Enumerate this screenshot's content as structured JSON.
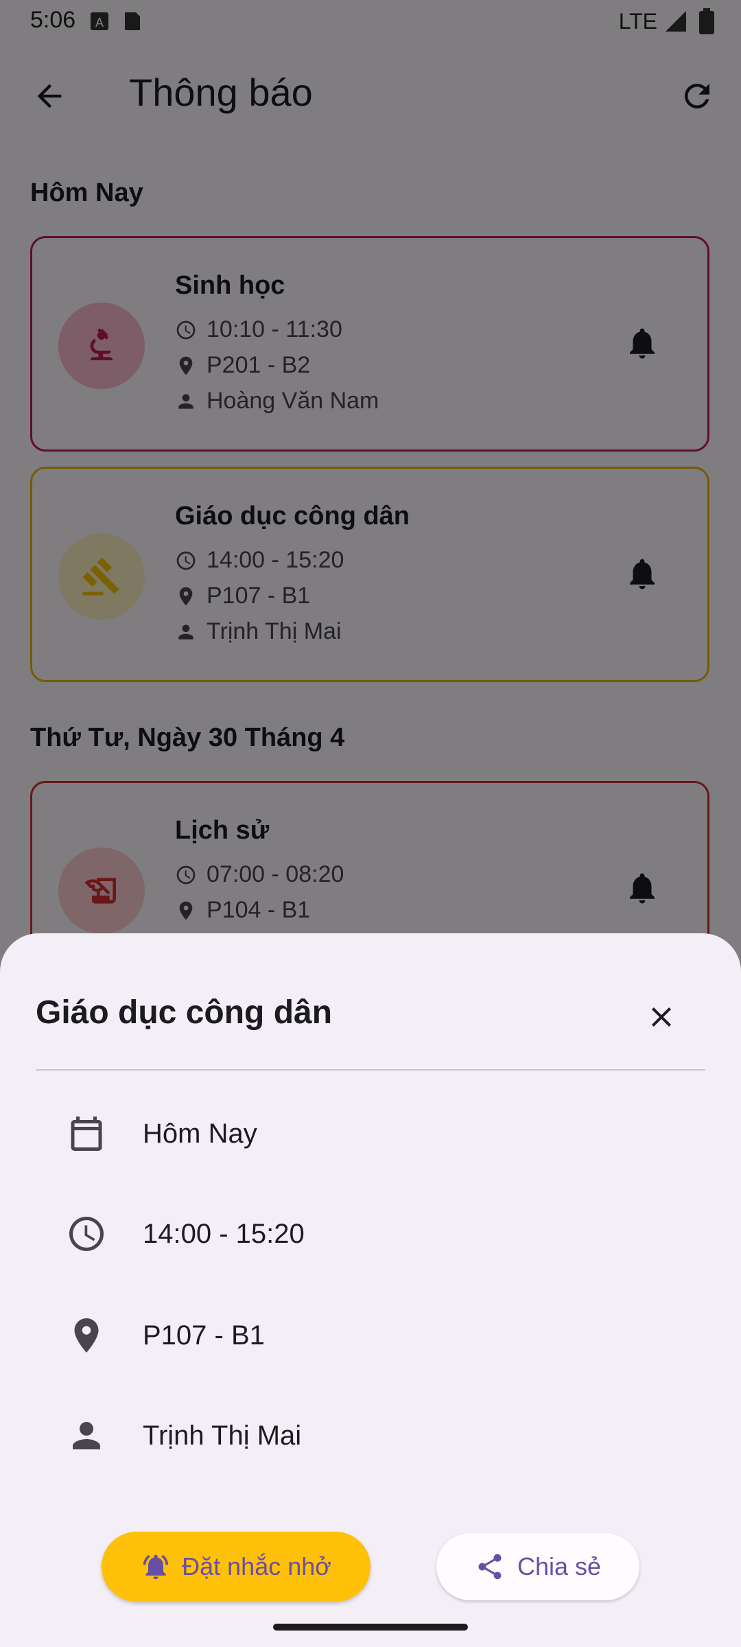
{
  "status_bar": {
    "time": "5:06",
    "network": "LTE"
  },
  "app_bar": {
    "title": "Thông báo"
  },
  "sections": [
    {
      "title": "Hôm Nay",
      "cards": [
        {
          "subject": "Sinh học",
          "time": "10:10 - 11:30",
          "room": "P201 - B2",
          "teacher": "Hoàng Văn Nam",
          "icon": "microscope-icon",
          "border_color": "#c2185b",
          "icon_color": "#c2185b",
          "icon_bg": "#f8bbd0"
        },
        {
          "subject": "Giáo dục công dân",
          "time": "14:00 - 15:20",
          "room": "P107 - B1",
          "teacher": "Trịnh Thị Mai",
          "icon": "gavel-icon",
          "border_color": "#e6b800",
          "icon_color": "#f5c400",
          "icon_bg": "#fff3c4"
        }
      ]
    },
    {
      "title": "Thứ Tư, Ngày 30 Tháng 4",
      "cards": [
        {
          "subject": "Lịch sử",
          "time": "07:00 - 08:20",
          "room": "P104 - B1",
          "icon": "history-edu-icon",
          "border_color": "#d32f2f",
          "icon_color": "#d32f2f",
          "icon_bg": "#ffcdd2"
        }
      ]
    }
  ],
  "sheet": {
    "title": "Giáo dục công dân",
    "details": [
      {
        "icon": "calendar-icon",
        "label": "Hôm Nay"
      },
      {
        "icon": "clock-icon",
        "label": "14:00 - 15:20"
      },
      {
        "icon": "location-icon",
        "label": "P107 - B1"
      },
      {
        "icon": "person-icon",
        "label": "Trịnh Thị Mai"
      }
    ],
    "remind_label": "Đặt nhắc nhở",
    "share_label": "Chia sẻ"
  },
  "colors": {
    "accent": "#6750a4",
    "remind_button": "#ffc107"
  }
}
